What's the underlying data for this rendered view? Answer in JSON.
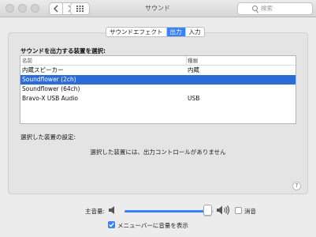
{
  "window": {
    "title": "サウンド",
    "search_placeholder": "検索"
  },
  "tabs": [
    {
      "label": "サウンドエフェクト",
      "active": false
    },
    {
      "label": "出力",
      "active": true
    },
    {
      "label": "入力",
      "active": false
    }
  ],
  "output": {
    "select_label": "サウンドを出力する装置を選択:",
    "columns": {
      "name": "名前",
      "type": "種類"
    },
    "devices": [
      {
        "name": "内蔵スピーカー",
        "type": "内蔵",
        "selected": false
      },
      {
        "name": "Soundflower (2ch)",
        "type": "",
        "selected": true
      },
      {
        "name": "Soundflower (64ch)",
        "type": "",
        "selected": false
      },
      {
        "name": "Bravo-X USB Audio",
        "type": "USB",
        "selected": false
      }
    ],
    "settings_label": "選択した装置の設定:",
    "no_controls_message": "選択した装置には、出力コントロールがありません"
  },
  "volume": {
    "label": "主音量:",
    "level": 0.93,
    "mute_label": "消音",
    "mute_checked": false
  },
  "menubar": {
    "label": "メニューバーに音量を表示",
    "checked": true
  },
  "colors": {
    "accent": "#3a82f7",
    "selection": "#2d6bd6"
  }
}
